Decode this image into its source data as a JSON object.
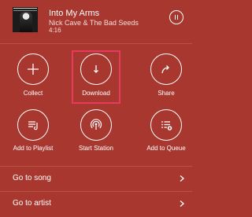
{
  "now_playing": {
    "title": "Into My Arms",
    "artist": "Nick Cave & The Bad Seeds",
    "time": "4:16"
  },
  "actions": [
    {
      "label": "Collect",
      "icon": "plus-icon"
    },
    {
      "label": "Download",
      "icon": "download-icon"
    },
    {
      "label": "Share",
      "icon": "share-icon"
    },
    {
      "label": "Add to Playlist",
      "icon": "add-to-playlist-icon"
    },
    {
      "label": "Start Station",
      "icon": "station-icon"
    },
    {
      "label": "Add to Queue",
      "icon": "add-to-queue-icon"
    }
  ],
  "menu": [
    {
      "label": "Go to song"
    },
    {
      "label": "Go to artist"
    }
  ],
  "colors": {
    "background": "#a8382f",
    "highlight": "#e63a5f",
    "foreground": "#ffffff"
  }
}
